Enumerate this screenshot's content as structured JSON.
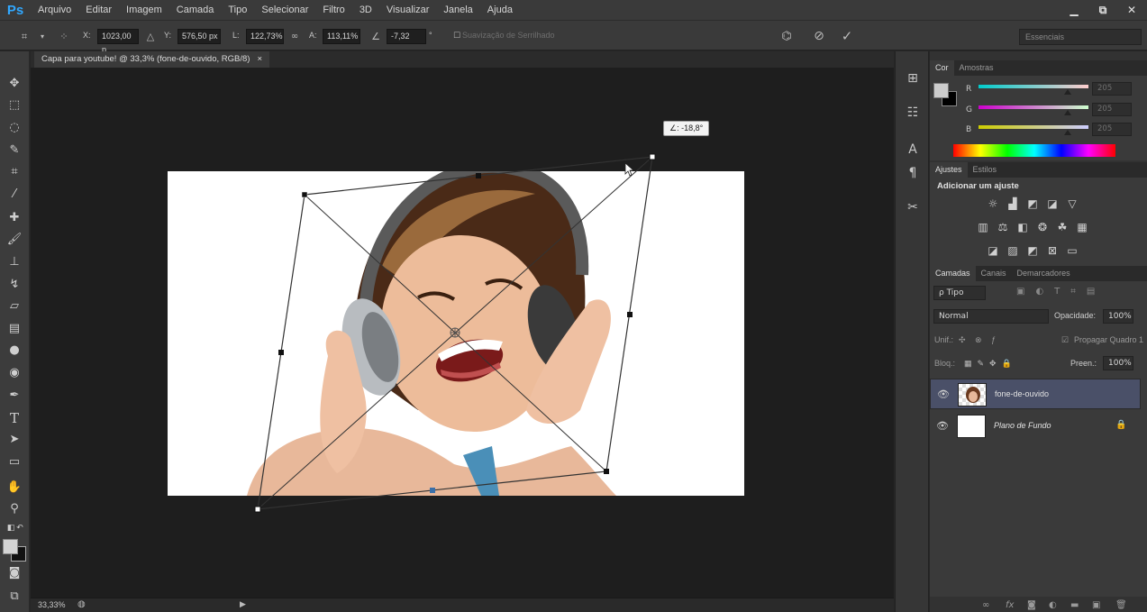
{
  "app": {
    "logo": "Ps"
  },
  "menu": [
    "Arquivo",
    "Editar",
    "Imagem",
    "Camada",
    "Tipo",
    "Selecionar",
    "Filtro",
    "3D",
    "Visualizar",
    "Janela",
    "Ajuda"
  ],
  "window_controls": {
    "minimize": "▁",
    "restore": "⧉",
    "close": "✕"
  },
  "options": {
    "x_label": "X:",
    "x_value": "1023,00 p",
    "y_label": "Y:",
    "y_value": "576,50 px",
    "w_label": "L:",
    "w_value": "122,73%",
    "h_label": "A:",
    "h_value": "113,11%",
    "angle_value": "-7,32",
    "degree": "°",
    "antialias_label": "Suavização de Serrilhado",
    "workspace": "Essenciais"
  },
  "document": {
    "tab_title": "Capa para youtube! @ 33,3% (fone-de-ouvido, RGB/8)",
    "tab_close": "×",
    "zoom": "33,33%",
    "rotation_tooltip": "∠: -18,8°"
  },
  "color_panel": {
    "tabs": [
      "Cor",
      "Amostras"
    ],
    "r_label": "R",
    "r_value": "205",
    "g_label": "G",
    "g_value": "205",
    "b_label": "B",
    "b_value": "205"
  },
  "adjustments_panel": {
    "tabs": [
      "Ajustes",
      "Estilos"
    ],
    "heading": "Adicionar um ajuste"
  },
  "layers_panel": {
    "tabs": [
      "Camadas",
      "Canais",
      "Demarcadores"
    ],
    "filter_label": "ρ Tipo",
    "blend_mode": "Normal",
    "opacity_label": "Opacidade:",
    "opacity_value": "100%",
    "unify_label": "Unif.:",
    "propagate_label": "Propagar Quadro 1",
    "lock_label": "Bloq.:",
    "fill_label": "Preen.:",
    "fill_value": "100%",
    "layers": [
      {
        "name": "fone-de-ouvido",
        "selected": true
      },
      {
        "name": "Plano de Fundo",
        "selected": false
      }
    ]
  },
  "colors": {
    "accent": "#31a8ff",
    "selected_layer": "#4a5068",
    "foreground": "#cdcdcd",
    "background": "#000000"
  }
}
